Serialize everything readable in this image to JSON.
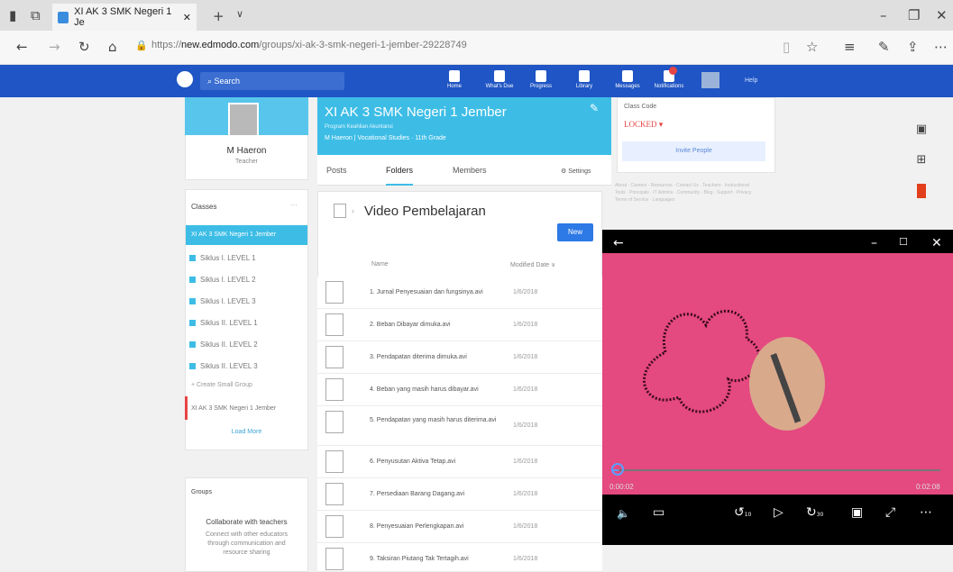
{
  "browser": {
    "tab_title": "XI AK 3 SMK Negeri 1 Je",
    "url_prefix": "https://",
    "url_host": "new.edmodo.com",
    "url_path": "/groups/xi-ak-3-smk-negeri-1-jember-29228749"
  },
  "header": {
    "search_placeholder": "Search",
    "nav": [
      {
        "label": "Home",
        "icon": "home-icon"
      },
      {
        "label": "What's Due",
        "icon": "calendar-icon"
      },
      {
        "label": "Progress",
        "icon": "progress-icon"
      },
      {
        "label": "Library",
        "icon": "library-icon"
      },
      {
        "label": "Messages",
        "icon": "messages-icon"
      },
      {
        "label": "Notifications",
        "icon": "bell-icon"
      }
    ],
    "help": "Help"
  },
  "profile": {
    "name": "M Haeron",
    "role": "Teacher"
  },
  "classes": {
    "title": "Classes",
    "more": "···",
    "active": "XI AK 3 SMK Negeri 1 Jember",
    "items": [
      "Siklus I. LEVEL 1",
      "Siklus I. LEVEL 2",
      "Siklus I. LEVEL 3",
      "Siklus II. LEVEL 1",
      "Siklus II. LEVEL 2",
      "Siklus II. LEVEL 3"
    ],
    "create_group": "+ Create Small Group",
    "current": "XI AK 3 SMK Negeri 1 Jember",
    "load_more": "Load More"
  },
  "groups": {
    "title": "Groups",
    "promo_title": "Collaborate with teachers",
    "promo_text": "Connect with other educators through communication and resource sharing"
  },
  "class_banner": {
    "title": "XI AK 3 SMK Negeri 1 Jember",
    "program": "Program Keahlian Akuntansi",
    "meta": "M Haeron | Vocational Studies · 11th Grade"
  },
  "class_tabs": {
    "posts": "Posts",
    "folders": "Folders",
    "members": "Members",
    "settings": "Settings"
  },
  "folder": {
    "title": "Video Pembelajaran",
    "new_button": "New",
    "col_name": "Name",
    "col_date": "Modified Date",
    "files": [
      {
        "name": "1. Jurnal Penyesuaian dan fungsinya.avi",
        "date": "1/6/2018"
      },
      {
        "name": "2. Beban Dibayar dimuka.avi",
        "date": "1/6/2018"
      },
      {
        "name": "3. Pendapatan diterima dimuka.avi",
        "date": "1/6/2018"
      },
      {
        "name": "4. Beban yang masih harus dibayar.avi",
        "date": "1/6/2018"
      },
      {
        "name": "5. Pendapatan yang masih harus diterima.avi",
        "date": "1/6/2018"
      },
      {
        "name": "6. Penyusutan Aktiva Tetap.avi",
        "date": "1/6/2018"
      },
      {
        "name": "7. Persediaan Barang Dagang.avi",
        "date": "1/6/2018"
      },
      {
        "name": "8. Penyesuaian Perlengkapan.avi",
        "date": "1/6/2018"
      },
      {
        "name": "9. Taksiran Piutang Tak Tertagih.avi",
        "date": "1/6/2018"
      }
    ]
  },
  "class_code": {
    "label": "Class Code",
    "value": "LOCKED",
    "invite": "Invite People",
    "footer": "About · Careers · Resources · Contact Us · Teachers · Instructional Tools · Principals · IT Admins · Community · Blog · Support · Privacy · Terms of Service · Languages"
  },
  "player": {
    "elapsed": "0:00:02",
    "duration": "0:02:08",
    "progress_fraction": 0.016,
    "skip_back": "10",
    "skip_forward": "30"
  }
}
